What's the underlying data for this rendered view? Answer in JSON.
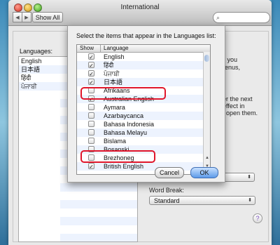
{
  "window": {
    "title": "International"
  },
  "toolbar": {
    "back_label": "◀",
    "forward_label": "▶",
    "show_all_label": "Show All",
    "search_placeholder": ""
  },
  "background": {
    "languages_label": "Languages:",
    "languages": [
      "English",
      "日本語",
      "हिंदी",
      "ਪੰਜਾਬੀ"
    ],
    "text_order": "rder you",
    "text_menus": "n menus,",
    "text_next": "inder the next",
    "text_effect": "se effect in",
    "text_open": "you open them.",
    "word_break_label": "Word Break:",
    "word_break_value": "Standard",
    "help_label": "?"
  },
  "sheet": {
    "prompt": "Select the items that appear in the Languages list:",
    "columns": {
      "show": "Show",
      "language": "Language"
    },
    "items": [
      {
        "label": "English",
        "checked": true
      },
      {
        "label": "हिंदी",
        "checked": true
      },
      {
        "label": "ਪੰਜਾਬੀ",
        "checked": true
      },
      {
        "label": "日本語",
        "checked": true
      },
      {
        "label": "Afrikaans",
        "checked": false
      },
      {
        "label": "Australian English",
        "checked": true
      },
      {
        "label": "Aymara",
        "checked": false
      },
      {
        "label": "Azarbaycanca",
        "checked": false
      },
      {
        "label": "Bahasa Indonesia",
        "checked": false
      },
      {
        "label": "Bahasa Melayu",
        "checked": false
      },
      {
        "label": "Bislama",
        "checked": false
      },
      {
        "label": "Bosanski",
        "checked": false
      },
      {
        "label": "Brezhoneg",
        "checked": false
      },
      {
        "label": "British English",
        "checked": true
      }
    ],
    "cancel_label": "Cancel",
    "ok_label": "OK"
  },
  "colors": {
    "highlight": "#e0162b",
    "default_button": "#5d9be9"
  }
}
